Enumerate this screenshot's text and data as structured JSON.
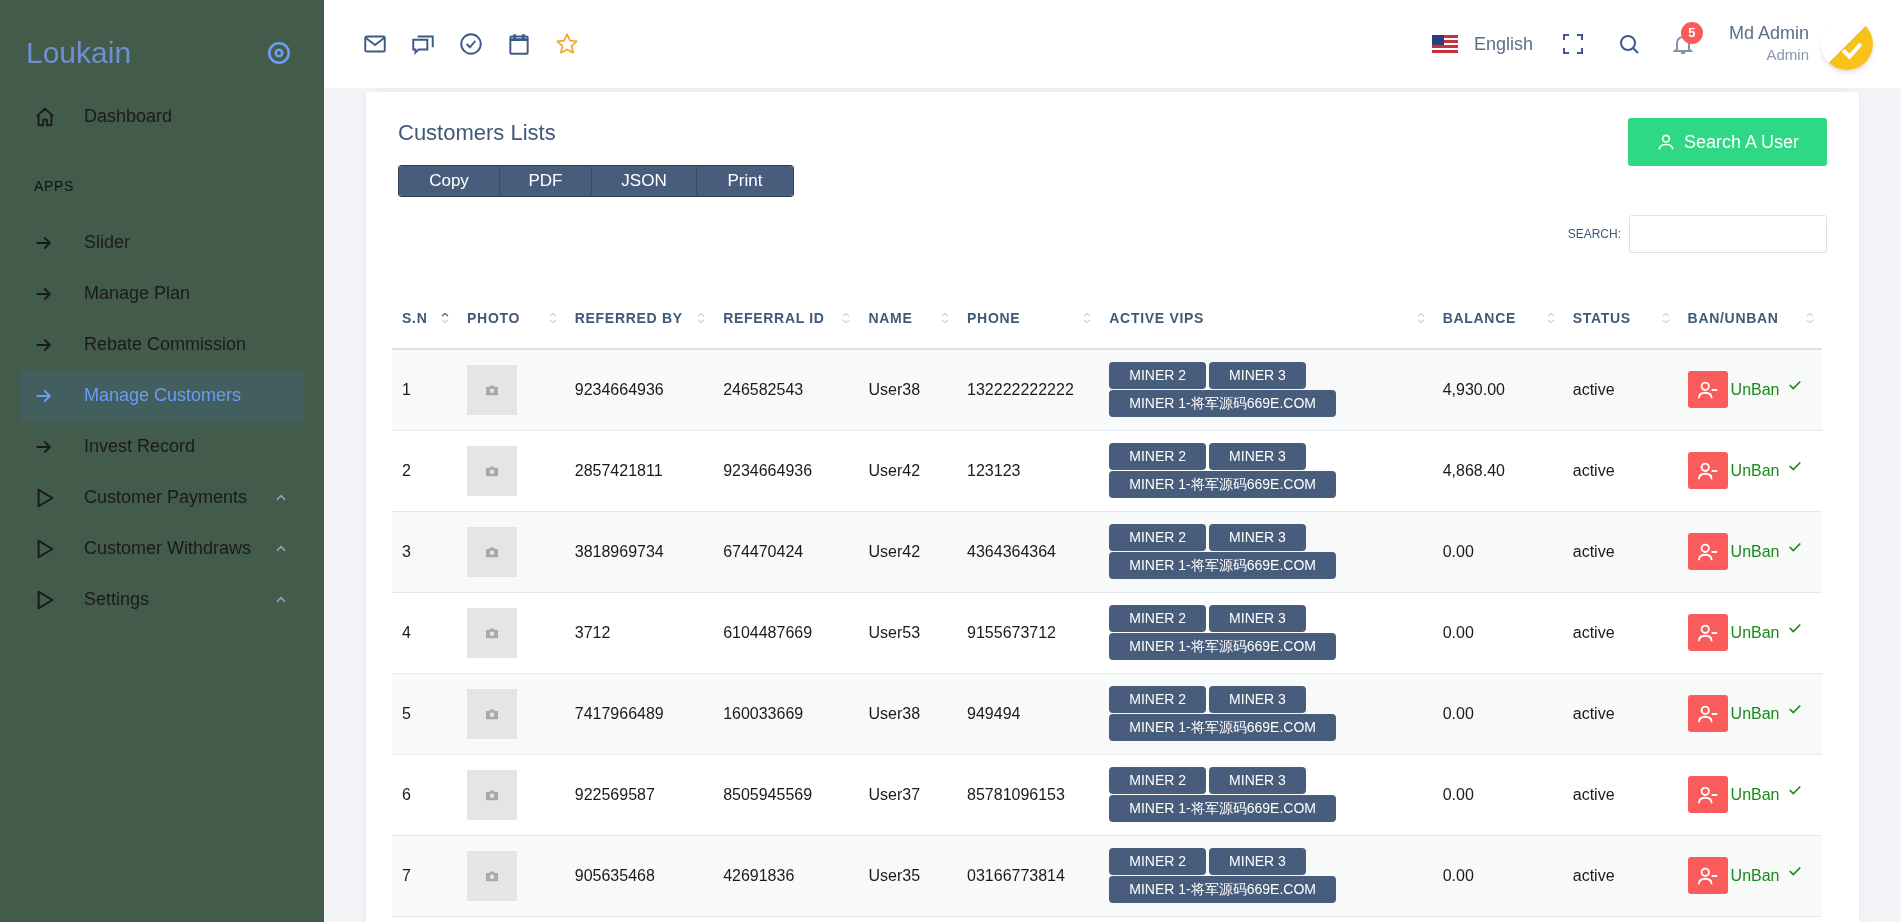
{
  "sidebar": {
    "brand": "Loukain",
    "items": [
      {
        "kind": "home",
        "label": "Dashboard",
        "selected": false
      },
      {
        "kind": "heading",
        "label": "APPS"
      },
      {
        "kind": "arrow",
        "label": "Slider",
        "selected": false
      },
      {
        "kind": "arrow",
        "label": "Manage Plan",
        "selected": false
      },
      {
        "kind": "arrow",
        "label": "Rebate Commission",
        "selected": false
      },
      {
        "kind": "arrow",
        "label": "Manage Customers",
        "selected": true
      },
      {
        "kind": "arrow",
        "label": "Invest Record",
        "selected": false
      },
      {
        "kind": "group",
        "label": "Customer Payments",
        "selected": false
      },
      {
        "kind": "group",
        "label": "Customer Withdraws",
        "selected": false
      },
      {
        "kind": "group",
        "label": "Settings",
        "selected": false
      }
    ]
  },
  "topbar": {
    "language": "English",
    "notifications": "5",
    "user_name": "Md Admin",
    "user_role": "Admin"
  },
  "card": {
    "title": "Customers Lists",
    "search_user_button": "Search A User",
    "export_buttons": [
      "Copy",
      "PDF",
      "JSON",
      "Print"
    ],
    "search_label": "SEARCH:"
  },
  "table": {
    "columns": [
      {
        "label": "S.N",
        "sorted": true
      },
      {
        "label": "PHOTO",
        "sorted": false
      },
      {
        "label": "REFERRED BY",
        "sorted": false
      },
      {
        "label": "REFERRAL ID",
        "sorted": false
      },
      {
        "label": "NAME",
        "sorted": false
      },
      {
        "label": "PHONE",
        "sorted": false
      },
      {
        "label": "ACTIVE VIPS",
        "sorted": false
      },
      {
        "label": "BALANCE",
        "sorted": false
      },
      {
        "label": "STATUS",
        "sorted": false
      },
      {
        "label": "BAN/UNBAN",
        "sorted": false
      }
    ],
    "rows": [
      {
        "sn": "1",
        "referred_by": "9234664936",
        "referral_id": "246582543",
        "name": "User38",
        "phone": "132222222222",
        "vips": [
          "MINER 2",
          "MINER 3",
          "MINER 1-将军源码669E.COM"
        ],
        "balance": "4,930.00",
        "status": "active",
        "action": "UnBan"
      },
      {
        "sn": "2",
        "referred_by": "2857421811",
        "referral_id": "9234664936",
        "name": "User42",
        "phone": "123123",
        "vips": [
          "MINER 2",
          "MINER 3",
          "MINER 1-将军源码669E.COM"
        ],
        "balance": "4,868.40",
        "status": "active",
        "action": "UnBan"
      },
      {
        "sn": "3",
        "referred_by": "3818969734",
        "referral_id": "674470424",
        "name": "User42",
        "phone": "4364364364",
        "vips": [
          "MINER 2",
          "MINER 3",
          "MINER 1-将军源码669E.COM"
        ],
        "balance": "0.00",
        "status": "active",
        "action": "UnBan"
      },
      {
        "sn": "4",
        "referred_by": "3712",
        "referral_id": "6104487669",
        "name": "User53",
        "phone": "9155673712",
        "vips": [
          "MINER 2",
          "MINER 3",
          "MINER 1-将军源码669E.COM"
        ],
        "balance": "0.00",
        "status": "active",
        "action": "UnBan"
      },
      {
        "sn": "5",
        "referred_by": "7417966489",
        "referral_id": "160033669",
        "name": "User38",
        "phone": "949494",
        "vips": [
          "MINER 2",
          "MINER 3",
          "MINER 1-将军源码669E.COM"
        ],
        "balance": "0.00",
        "status": "active",
        "action": "UnBan"
      },
      {
        "sn": "6",
        "referred_by": "922569587",
        "referral_id": "8505945569",
        "name": "User37",
        "phone": "85781096153",
        "vips": [
          "MINER 2",
          "MINER 3",
          "MINER 1-将军源码669E.COM"
        ],
        "balance": "0.00",
        "status": "active",
        "action": "UnBan"
      },
      {
        "sn": "7",
        "referred_by": "905635468",
        "referral_id": "42691836",
        "name": "User35",
        "phone": "03166773814",
        "vips": [
          "MINER 2",
          "MINER 3",
          "MINER 1-将军源码669E.COM"
        ],
        "balance": "0.00",
        "status": "active",
        "action": "UnBan"
      }
    ]
  }
}
